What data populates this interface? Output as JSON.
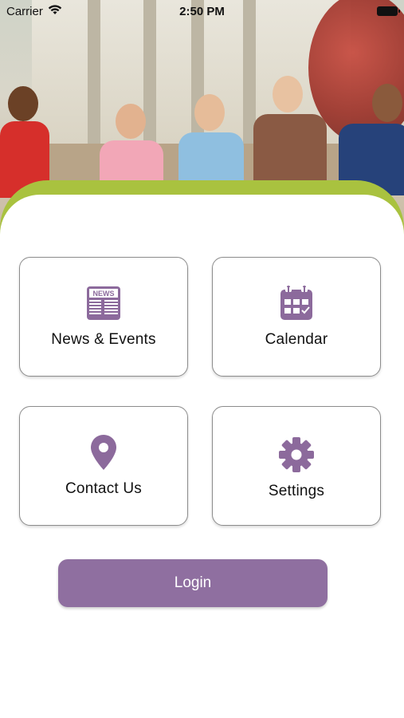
{
  "status_bar": {
    "carrier": "Carrier",
    "time": "2:50 PM"
  },
  "hero": {
    "image_description": "Children with backpacks running in front of a school"
  },
  "menu": {
    "tiles": [
      {
        "label": "News & Events",
        "icon": "newspaper-icon",
        "icon_text": "NEWS"
      },
      {
        "label": "Calendar",
        "icon": "calendar-icon"
      },
      {
        "label": "Contact Us",
        "icon": "map-pin-icon"
      },
      {
        "label": "Settings",
        "icon": "gear-icon"
      }
    ]
  },
  "login": {
    "label": "Login"
  },
  "colors": {
    "accent_purple": "#8f6fa0",
    "icon_purple": "#8c6a9c",
    "band_green": "#a9c23f"
  }
}
